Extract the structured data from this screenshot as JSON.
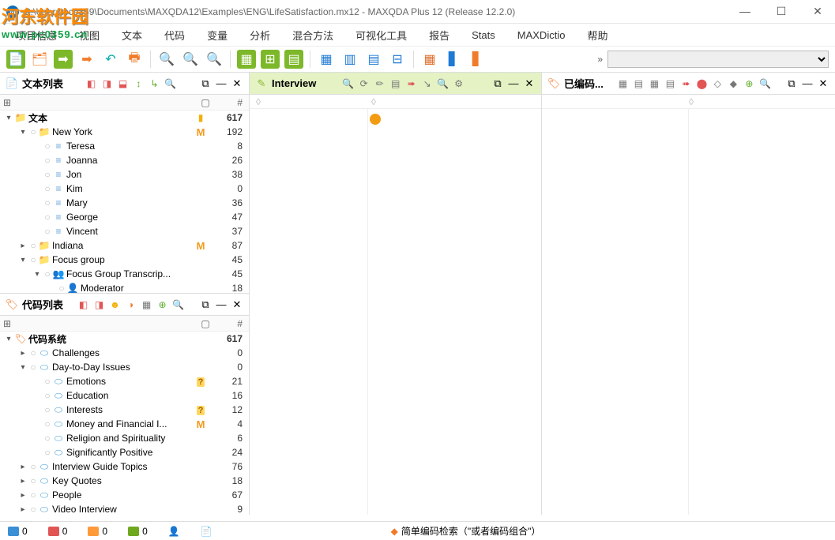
{
  "title": "C:\\Users\\pc0359\\Documents\\MAXQDA12\\Examples\\ENG\\LifeSatisfaction.mx12 - MAXQDA Plus 12  (Release 12.2.0)",
  "watermark": {
    "logo": "河东软件园",
    "url": "www.pc0359.cn"
  },
  "menu": [
    "项目信息",
    "视图",
    "文本",
    "代码",
    "变量",
    "分析",
    "混合方法",
    "可视化工具",
    "报告",
    "Stats",
    "MAXDictio",
    "帮助"
  ],
  "toolbar_more": "»",
  "doc_panel": {
    "title": "文本列表",
    "cols": {
      "c1": "",
      "c2": "#",
      "c3": ""
    },
    "root": {
      "label": "文本",
      "count": 617
    },
    "tree": [
      {
        "depth": 1,
        "exp": "▾",
        "ico": "folder",
        "label": "New York",
        "memo": "M",
        "count": 192
      },
      {
        "depth": 2,
        "exp": "",
        "ico": "doc",
        "label": "Teresa",
        "count": 8
      },
      {
        "depth": 2,
        "exp": "",
        "ico": "doc",
        "label": "Joanna",
        "count": 26
      },
      {
        "depth": 2,
        "exp": "",
        "ico": "doc",
        "label": "Jon",
        "count": 38
      },
      {
        "depth": 2,
        "exp": "",
        "ico": "doc",
        "label": "Kim",
        "count": 0
      },
      {
        "depth": 2,
        "exp": "",
        "ico": "doc",
        "label": "Mary",
        "count": 36
      },
      {
        "depth": 2,
        "exp": "",
        "ico": "doc",
        "label": "George",
        "count": 47
      },
      {
        "depth": 2,
        "exp": "",
        "ico": "doc",
        "label": "Vincent",
        "count": 37
      },
      {
        "depth": 1,
        "exp": "▸",
        "ico": "folder",
        "label": "Indiana",
        "memo": "M",
        "count": 87
      },
      {
        "depth": 1,
        "exp": "▾",
        "ico": "folder",
        "label": "Focus group",
        "count": 45
      },
      {
        "depth": 2,
        "exp": "▾",
        "ico": "fg",
        "label": "Focus Group Transcrip...",
        "count": 45
      },
      {
        "depth": 3,
        "exp": "",
        "ico": "person",
        "label": "Moderator",
        "count": 18
      }
    ]
  },
  "code_panel": {
    "title": "代码列表",
    "cols": {
      "c1": "",
      "c2": "#",
      "c3": ""
    },
    "root": {
      "label": "代码系统",
      "count": 617
    },
    "tree": [
      {
        "depth": 1,
        "exp": "▸",
        "ico": "code",
        "label": "Challenges",
        "count": 0
      },
      {
        "depth": 1,
        "exp": "▾",
        "ico": "code",
        "label": "Day-to-Day Issues",
        "count": 0
      },
      {
        "depth": 2,
        "exp": "",
        "ico": "code",
        "label": "Emotions",
        "memo": "?",
        "count": 21
      },
      {
        "depth": 2,
        "exp": "",
        "ico": "code",
        "label": "Education",
        "count": 16
      },
      {
        "depth": 2,
        "exp": "",
        "ico": "code",
        "label": "Interests",
        "memo": "?",
        "count": 12
      },
      {
        "depth": 2,
        "exp": "",
        "ico": "code",
        "label": "Money and Financial I...",
        "memo": "M",
        "count": 4
      },
      {
        "depth": 2,
        "exp": "",
        "ico": "code",
        "label": "Religion and Spirituality",
        "count": 6
      },
      {
        "depth": 2,
        "exp": "",
        "ico": "code",
        "label": "Significantly Positive",
        "count": 24
      },
      {
        "depth": 1,
        "exp": "▸",
        "ico": "code",
        "label": "Interview Guide Topics",
        "count": 76
      },
      {
        "depth": 1,
        "exp": "▸",
        "ico": "code",
        "label": "Key Quotes",
        "count": 18
      },
      {
        "depth": 1,
        "exp": "▸",
        "ico": "code",
        "label": "People",
        "count": 67
      },
      {
        "depth": 1,
        "exp": "▸",
        "ico": "code",
        "label": "Video Interview",
        "count": 9
      }
    ]
  },
  "browser_panel": {
    "title": "Interview"
  },
  "retrieved_panel": {
    "title": "已编码..."
  },
  "ruler_marks": {
    "d1": "◊",
    "d2": "◊"
  },
  "status": {
    "items": [
      {
        "color": "#3b8fd6",
        "val": "0"
      },
      {
        "color": "#e25555",
        "val": "0"
      },
      {
        "color": "#ff9a3a",
        "val": "0"
      },
      {
        "color": "#6fa81f",
        "val": "0"
      }
    ],
    "person": "",
    "doc": "",
    "search_label": "简单编码检索（\"或者编码组合\"）"
  }
}
